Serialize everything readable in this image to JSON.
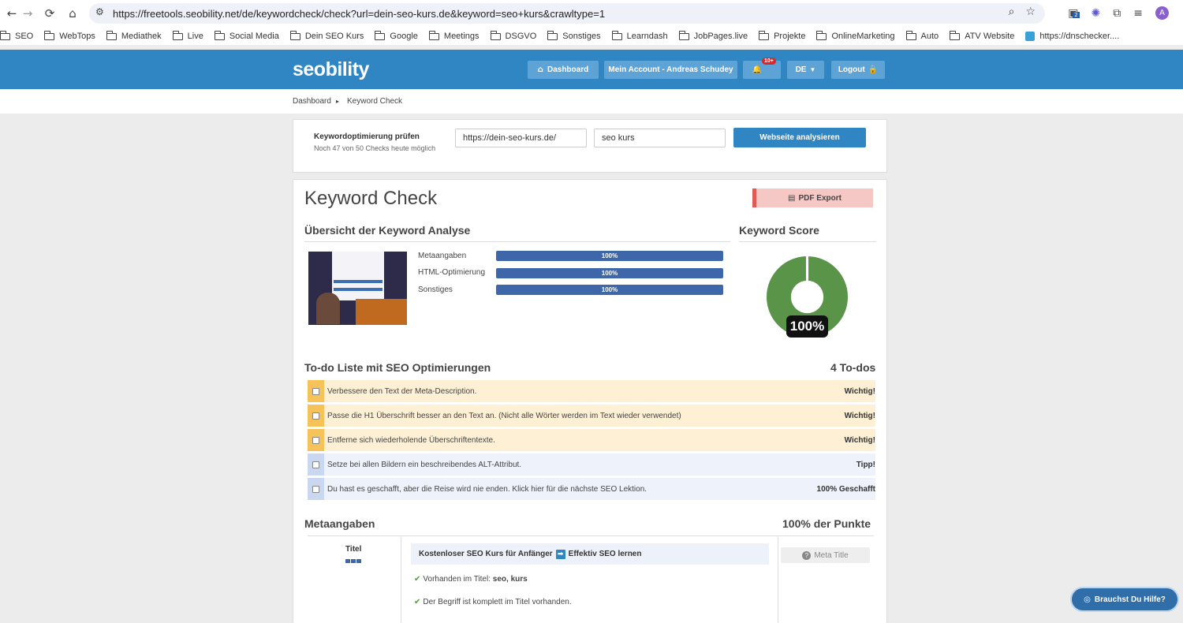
{
  "browser": {
    "url": "https://freetools.seobility.net/de/keywordcheck/check?url=dein-seo-kurs.de&keyword=seo+kurs&crawltype=1",
    "ext_badge": "2",
    "avatar_letter": "A",
    "bookmarks": [
      "SEO",
      "WebTops",
      "Mediathek",
      "Live",
      "Social Media",
      "Dein SEO Kurs",
      "Google",
      "Meetings",
      "DSGVO",
      "Sonstiges",
      "Learndash",
      "JobPages.live",
      "Projekte",
      "OnlineMarketing",
      "Auto",
      "ATV Website",
      "https://dnschecker...."
    ]
  },
  "header": {
    "logo": "seobility",
    "dashboard_label": "Dashboard",
    "account_label": "Mein Account - Andreas Schudey",
    "notif_badge": "10+",
    "lang_label": "DE",
    "logout_label": "Logout",
    "accent_color": "#2f86c3"
  },
  "breadcrumb": {
    "home": "Dashboard",
    "current": "Keyword Check"
  },
  "form": {
    "title": "Keywordoptimierung prüfen",
    "subtitle": "Noch 47 von 50 Checks heute möglich",
    "url_value": "https://dein-seo-kurs.de/",
    "keyword_value": "seo kurs",
    "submit_label": "Webseite analysieren"
  },
  "report": {
    "title": "Keyword Check",
    "pdf_label": "PDF Export",
    "overview_title": "Übersicht der Keyword Analyse",
    "score_title": "Keyword Score",
    "score_value": "100%",
    "score_fraction": 1.0,
    "metrics": [
      {
        "label": "Metaangaben",
        "value": "100%",
        "fraction": 1.0
      },
      {
        "label": "HTML-Optimierung",
        "value": "100%",
        "fraction": 1.0
      },
      {
        "label": "Sonstiges",
        "value": "100%",
        "fraction": 1.0
      }
    ]
  },
  "todo": {
    "title": "To-do Liste mit SEO Optimierungen",
    "count": "4 To-dos",
    "items": [
      {
        "text": "Verbessere den Text der Meta-Description.",
        "level": "Wichtig!",
        "type": "important"
      },
      {
        "text": "Passe die H1 Überschrift besser an den Text an. (Nicht alle Wörter werden im Text wieder verwendet)",
        "level": "Wichtig!",
        "type": "important"
      },
      {
        "text": "Entferne sich wiederholende Überschriftentexte.",
        "level": "Wichtig!",
        "type": "important"
      },
      {
        "text": "Setze bei allen Bildern ein beschreibendes ALT-Attribut.",
        "level": "Tipp!",
        "type": "tip"
      },
      {
        "text": "Du hast es geschafft, aber die Reise wird nie enden. Klick hier für die nächste SEO Lektion.",
        "level": "100% Geschafft",
        "type": "tip"
      }
    ]
  },
  "meta": {
    "title": "Metaangaben",
    "points": "100% der Punkte",
    "row_label": "Titel",
    "page_title_part1": "Kostenloser SEO Kurs für Anfänger",
    "page_title_arrow": "➡",
    "page_title_part2": "Effektiv SEO lernen",
    "check1_prefix": "Vorhanden im Titel:",
    "check1_value": "seo, kurs",
    "check2": "Der Begriff ist komplett im Titel vorhanden.",
    "meta_button": "Meta Title"
  },
  "help_button": "Brauchst Du Hilfe?",
  "colors": {
    "important_bg": "#fdf0d4",
    "important_tab": "#f5c35a",
    "tip_bg": "#edf2fb",
    "tip_tab": "#c9d8f0",
    "score_green": "#5a9448"
  }
}
